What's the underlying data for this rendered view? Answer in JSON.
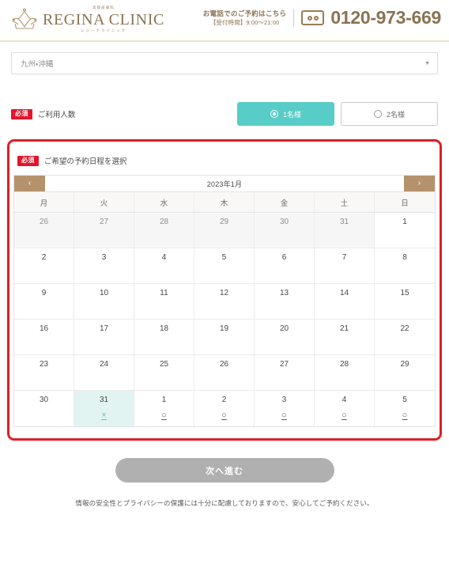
{
  "header": {
    "logo": {
      "sup_text": "美容皮膚科",
      "main_text": "REGINA CLINIC",
      "sub_text": "レジーナクリニック"
    },
    "tel": {
      "line1": "お電話でのご予約はこちら",
      "line2": "【受付時間】9:00〜21:00",
      "number": "0120-973-669",
      "number_color": "#8a7353"
    }
  },
  "region": {
    "selected": "九州・沖縄",
    "caret": "▼"
  },
  "people": {
    "badge": "必須",
    "label": "ご利用人数",
    "options": [
      {
        "label": "1名様",
        "selected": true
      },
      {
        "label": "2名様",
        "selected": false
      }
    ],
    "selected_color": "#58ccc6"
  },
  "schedule": {
    "badge": "必須",
    "label": "ご希望の予約日程を選択",
    "box_border_color": "#dd2025"
  },
  "calendar": {
    "prev_icon": "‹",
    "next_icon": "›",
    "nav_color": "#b4936c",
    "title": "2023年1月",
    "weekdays": [
      "月",
      "火",
      "水",
      "木",
      "金",
      "土",
      "日"
    ],
    "weeks": [
      [
        {
          "day": "26",
          "muted": true,
          "mark": ""
        },
        {
          "day": "27",
          "muted": true,
          "mark": ""
        },
        {
          "day": "28",
          "muted": true,
          "mark": ""
        },
        {
          "day": "29",
          "muted": true,
          "mark": ""
        },
        {
          "day": "30",
          "muted": true,
          "mark": ""
        },
        {
          "day": "31",
          "muted": true,
          "mark": ""
        },
        {
          "day": "1",
          "muted": false,
          "mark": ""
        }
      ],
      [
        {
          "day": "2",
          "muted": false,
          "mark": ""
        },
        {
          "day": "3",
          "muted": false,
          "mark": ""
        },
        {
          "day": "4",
          "muted": false,
          "mark": ""
        },
        {
          "day": "5",
          "muted": false,
          "mark": ""
        },
        {
          "day": "6",
          "muted": false,
          "mark": ""
        },
        {
          "day": "7",
          "muted": false,
          "mark": ""
        },
        {
          "day": "8",
          "muted": false,
          "mark": ""
        }
      ],
      [
        {
          "day": "9",
          "muted": false,
          "mark": ""
        },
        {
          "day": "10",
          "muted": false,
          "mark": ""
        },
        {
          "day": "11",
          "muted": false,
          "mark": ""
        },
        {
          "day": "12",
          "muted": false,
          "mark": ""
        },
        {
          "day": "13",
          "muted": false,
          "mark": ""
        },
        {
          "day": "14",
          "muted": false,
          "mark": ""
        },
        {
          "day": "15",
          "muted": false,
          "mark": ""
        }
      ],
      [
        {
          "day": "16",
          "muted": false,
          "mark": ""
        },
        {
          "day": "17",
          "muted": false,
          "mark": ""
        },
        {
          "day": "18",
          "muted": false,
          "mark": ""
        },
        {
          "day": "19",
          "muted": false,
          "mark": ""
        },
        {
          "day": "20",
          "muted": false,
          "mark": ""
        },
        {
          "day": "21",
          "muted": false,
          "mark": ""
        },
        {
          "day": "22",
          "muted": false,
          "mark": ""
        }
      ],
      [
        {
          "day": "23",
          "muted": false,
          "mark": ""
        },
        {
          "day": "24",
          "muted": false,
          "mark": ""
        },
        {
          "day": "25",
          "muted": false,
          "mark": ""
        },
        {
          "day": "26",
          "muted": false,
          "mark": ""
        },
        {
          "day": "27",
          "muted": false,
          "mark": ""
        },
        {
          "day": "28",
          "muted": false,
          "mark": ""
        },
        {
          "day": "29",
          "muted": false,
          "mark": ""
        }
      ],
      [
        {
          "day": "30",
          "muted": false,
          "mark": ""
        },
        {
          "day": "31",
          "muted": false,
          "mark": "×",
          "picked": true
        },
        {
          "day": "1",
          "muted": false,
          "mark": "○"
        },
        {
          "day": "2",
          "muted": false,
          "mark": "○"
        },
        {
          "day": "3",
          "muted": false,
          "mark": "○"
        },
        {
          "day": "4",
          "muted": false,
          "mark": "○"
        },
        {
          "day": "5",
          "muted": false,
          "mark": "○"
        }
      ]
    ]
  },
  "submit": {
    "label": "次へ進む",
    "disabled_color": "#b0b0b0"
  },
  "footer": {
    "note": "情報の安全性とプライバシーの保護には十分に配慮しておりますので、安心してご予約ください。"
  }
}
